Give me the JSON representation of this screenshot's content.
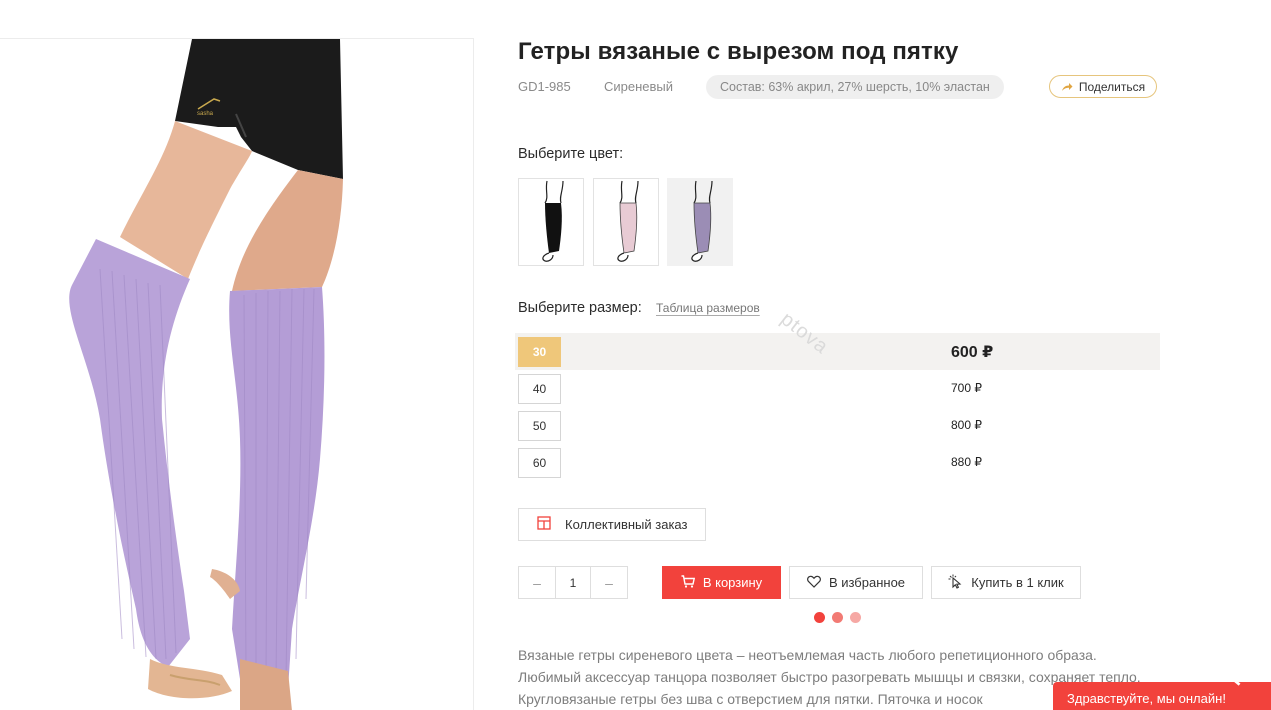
{
  "product": {
    "title": "Гетры вязаные с вырезом под пятку",
    "sku": "GD1-985",
    "color_name": "Сиреневый",
    "composition": "Состав: 63% акрил, 27% шерсть, 10% эластан",
    "share_label": "Поделиться",
    "image_brand_text": "sasha"
  },
  "color_picker": {
    "label": "Выберите цвет:",
    "swatches": [
      {
        "name": "black",
        "hex": "#111111",
        "selected": false
      },
      {
        "name": "pink",
        "hex": "#e8cbd4",
        "selected": false
      },
      {
        "name": "lilac",
        "hex": "#9b8db5",
        "selected": true
      }
    ]
  },
  "size_picker": {
    "label": "Выберите размер:",
    "table_link": "Таблица размеров",
    "sizes": [
      {
        "size": "30",
        "price": "600 ₽",
        "selected": true
      },
      {
        "size": "40",
        "price": "700 ₽",
        "selected": false
      },
      {
        "size": "50",
        "price": "800 ₽",
        "selected": false
      },
      {
        "size": "60",
        "price": "880 ₽",
        "selected": false
      }
    ],
    "watermark": "ptova"
  },
  "actions": {
    "collective_order": "Коллективный заказ",
    "qty_minus": "–",
    "qty_value": "1",
    "qty_plus": "–",
    "add_to_cart": "В корзину",
    "favorites": "В избранное",
    "one_click": "Купить в 1 клик"
  },
  "carousel_dots": [
    "#f2423c",
    "#f27a74",
    "#f6a8a4"
  ],
  "description": "Вязаные гетры сиреневого цвета – неотъемлемая часть любого репетиционного образа. Любимый аксессуар танцора позволяет быстро разогревать мышцы и связки, сохраняет тепло. Кругловязаные гетры без шва с отверстием для пятки. Пяточка и носок",
  "chat": {
    "label": "Здравствуйте, мы онлайн!",
    "corner_text": "ru"
  },
  "colors": {
    "accent_red": "#f2423c",
    "size_selected": "#efc77a",
    "lilac": "#b9a3d9"
  }
}
